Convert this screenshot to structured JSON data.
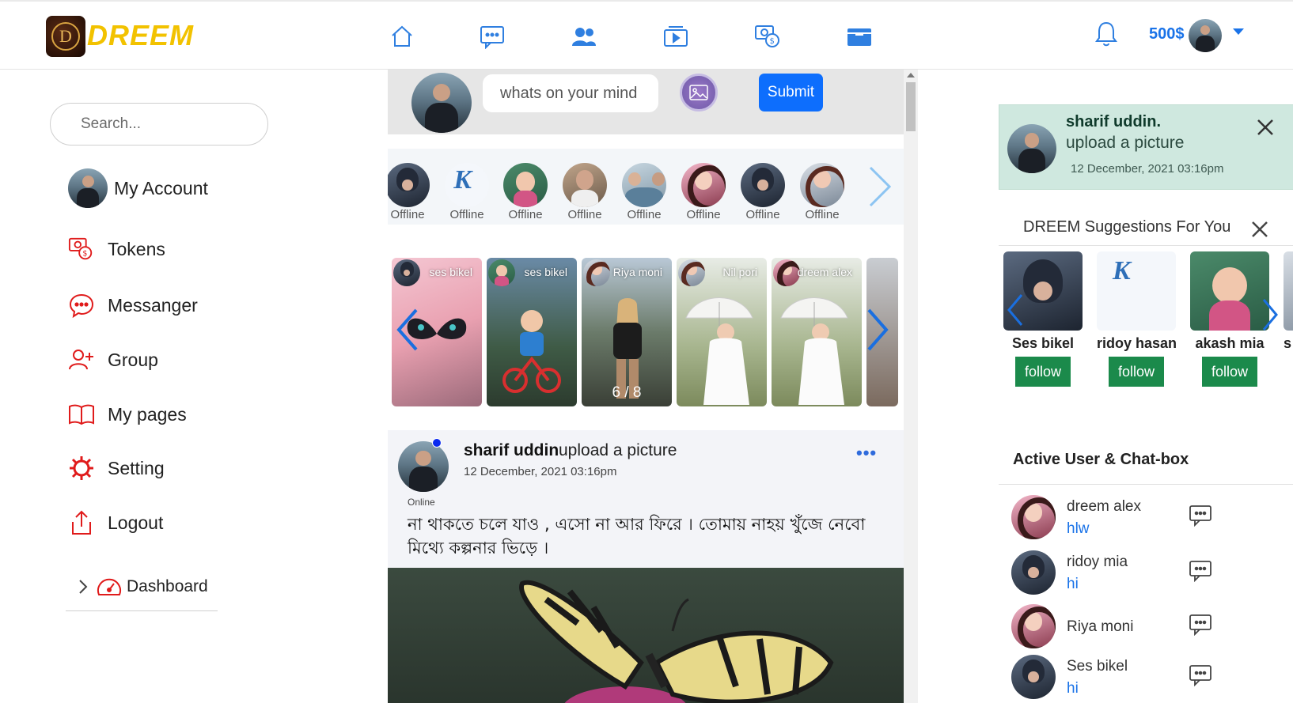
{
  "brand": {
    "name": "DREEM",
    "badge_letter": "D",
    "color": "#f2c200"
  },
  "header": {
    "nav": [
      {
        "name": "home-icon"
      },
      {
        "name": "messages-icon"
      },
      {
        "name": "friends-icon"
      },
      {
        "name": "video-icon"
      },
      {
        "name": "tokens-icon"
      },
      {
        "name": "wallet-icon"
      }
    ],
    "balance": "500$",
    "accent": "#1a73e8"
  },
  "sidebar": {
    "search_placeholder": "Search...",
    "items": [
      {
        "label": "My Account",
        "icon": "avatar"
      },
      {
        "label": "Tokens",
        "icon": "tokens-icon"
      },
      {
        "label": "Messanger",
        "icon": "chat-icon"
      },
      {
        "label": "Group",
        "icon": "add-user-icon"
      },
      {
        "label": "My pages",
        "icon": "book-icon"
      },
      {
        "label": "Setting",
        "icon": "gear-icon"
      },
      {
        "label": "Logout",
        "icon": "upload-icon"
      }
    ],
    "dashboard_label": "Dashboard",
    "icon_color": "#e01b1b"
  },
  "composer": {
    "placeholder": "whats on your mind",
    "submit_label": "Submit"
  },
  "friends": [
    {
      "status": "Offline"
    },
    {
      "status": "Offline"
    },
    {
      "status": "Offline"
    },
    {
      "status": "Offline"
    },
    {
      "status": "Offline"
    },
    {
      "status": "Offline"
    },
    {
      "status": "Offline"
    },
    {
      "status": "Offline"
    }
  ],
  "stories": [
    {
      "name": "ses bikel"
    },
    {
      "name": "ses bikel"
    },
    {
      "name": "Riya moni",
      "counter": "6 / 8"
    },
    {
      "name": "Nil pori"
    },
    {
      "name": "dreem alex"
    }
  ],
  "post": {
    "author": "sharif uddin",
    "action": "upload a picture",
    "time": "12 December, 2021 03:16pm",
    "presence": "Online",
    "text": "না থাকতে চলে যাও , এসো না আর ফিরে । তোমায় নাহয় খুঁজে নেবো মিথ্যে কল্পনার ভিড়ে ।"
  },
  "notification": {
    "name": "sharif uddin.",
    "action": "upload a picture",
    "time": "12 December, 2021 03:16pm",
    "bg": "#cfe8df"
  },
  "suggestions": {
    "title": "DREEM Suggestions For You",
    "follow_label": "follow",
    "people": [
      {
        "name": "Ses bikel"
      },
      {
        "name": "ridoy hasan"
      },
      {
        "name": "akash mia"
      },
      {
        "name": "s"
      }
    ],
    "button_color": "#1b8a4b"
  },
  "active": {
    "title": "Active User & Chat-box",
    "users": [
      {
        "name": "dreem alex",
        "message": "hlw"
      },
      {
        "name": "ridoy mia",
        "message": "hi"
      },
      {
        "name": "Riya moni",
        "message": ""
      },
      {
        "name": "Ses bikel",
        "message": "hi"
      }
    ]
  }
}
